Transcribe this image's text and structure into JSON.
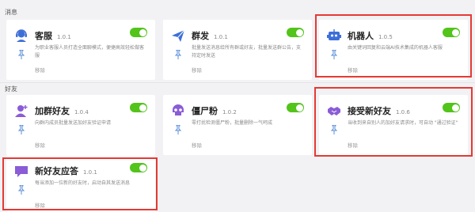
{
  "sections": [
    {
      "title": "消息"
    },
    {
      "title": "好友"
    }
  ],
  "cards": [
    {
      "title": "客服",
      "version": "1.0.1",
      "desc": "为职业客服人员打造全面聊模式，便捷高效轻松做客服",
      "remove": "移除",
      "icon": "customer-service-icon"
    },
    {
      "title": "群发",
      "version": "1.0.1",
      "desc": "批量发送消息给所有群或好友，批量发送群公告，支持定时发送",
      "remove": "移除",
      "icon": "send-icon"
    },
    {
      "title": "机器人",
      "version": "1.0.5",
      "desc": "由关键词回复和云端AI技术集成的机器人客服",
      "remove": "移除",
      "icon": "robot-icon"
    },
    {
      "title": "加群好友",
      "version": "1.0.4",
      "desc": "向群内成员批量发送加好友验证申请",
      "remove": "移除",
      "icon": "add-group-friend-icon"
    },
    {
      "title": "僵尸粉",
      "version": "1.0.2",
      "desc": "零打扰检测僵尸粉，批量删除一气呵成",
      "remove": "移除",
      "icon": "zombie-icon"
    },
    {
      "title": "接受新好友",
      "version": "1.0.6",
      "desc": "当收到来自别人的加好友请求时，可自动 \"通过验证\"",
      "remove": "移除",
      "icon": "handshake-icon"
    },
    {
      "title": "新好友应答",
      "version": "1.0.1",
      "desc": "每当添加一位新的好友时，启动自其发送消息",
      "remove": "移除",
      "icon": "chat-bubble-icon"
    }
  ],
  "colors": {
    "accent": "#52c41a",
    "highlight": "#e53935",
    "icon_blue": "#3e6fd8",
    "icon_purple": "#8a5cd6"
  }
}
